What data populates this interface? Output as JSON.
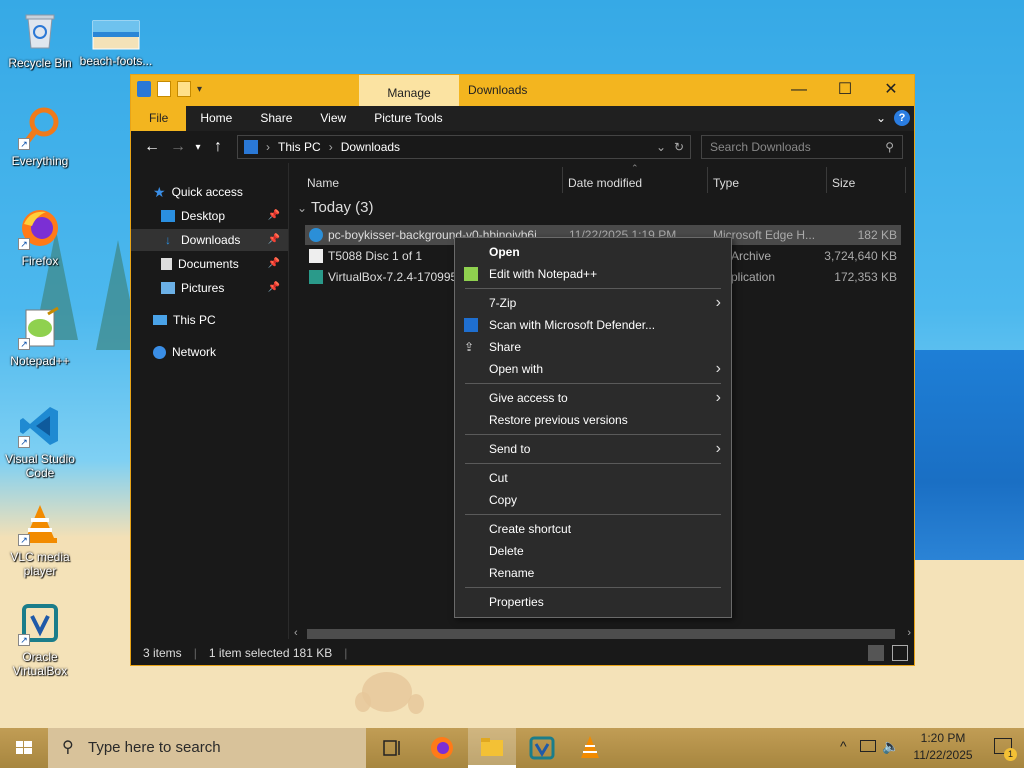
{
  "desktop": {
    "icons": [
      {
        "label": "Recycle Bin"
      },
      {
        "label": "beach-foots..."
      },
      {
        "label": "Everything"
      },
      {
        "label": "Firefox"
      },
      {
        "label": "Notepad++"
      },
      {
        "label": "Visual Studio Code"
      },
      {
        "label": "VLC media player"
      },
      {
        "label": "Oracle VirtualBox"
      }
    ]
  },
  "window": {
    "title": "Downloads",
    "manage_tab": "Manage",
    "ribbon_tabs": [
      "File",
      "Home",
      "Share",
      "View",
      "Picture Tools"
    ],
    "breadcrumb": [
      "This PC",
      "Downloads"
    ],
    "search_placeholder": "Search Downloads",
    "nav": {
      "quick_access": "Quick access",
      "items": [
        "Desktop",
        "Downloads",
        "Documents",
        "Pictures"
      ],
      "this_pc": "This PC",
      "network": "Network"
    },
    "columns": [
      "Name",
      "Date modified",
      "Type",
      "Size"
    ],
    "group_label": "Today (3)",
    "files": [
      {
        "name": "pc-boykisser-background-v0-hbinoivb6i...",
        "date": "11/22/2025 1:19 PM",
        "type": "Microsoft Edge H...",
        "size": "182 KB"
      },
      {
        "name": "T5088 Disc 1 of 1",
        "date": "",
        "type": "Archive",
        "size": "3,724,640 KB"
      },
      {
        "name": "VirtualBox-7.2.4-170995-...",
        "date": "",
        "type": "plication",
        "size": "172,353 KB"
      }
    ],
    "status": {
      "count": "3 items",
      "selected": "1 item selected  181 KB"
    }
  },
  "context_menu": {
    "items": [
      {
        "label": "Open",
        "bold": true
      },
      {
        "label": "Edit with Notepad++"
      },
      {
        "label": "7-Zip",
        "submenu": true
      },
      {
        "label": "Scan with Microsoft Defender..."
      },
      {
        "label": "Share"
      },
      {
        "label": "Open with",
        "submenu": true
      },
      {
        "label": "Give access to",
        "submenu": true
      },
      {
        "label": "Restore previous versions"
      },
      {
        "label": "Send to",
        "submenu": true
      },
      {
        "label": "Cut"
      },
      {
        "label": "Copy"
      },
      {
        "label": "Create shortcut"
      },
      {
        "label": "Delete"
      },
      {
        "label": "Rename"
      },
      {
        "label": "Properties"
      }
    ]
  },
  "taskbar": {
    "search_placeholder": "Type here to search",
    "time": "1:20 PM",
    "date": "11/22/2025",
    "notification_count": "1"
  }
}
